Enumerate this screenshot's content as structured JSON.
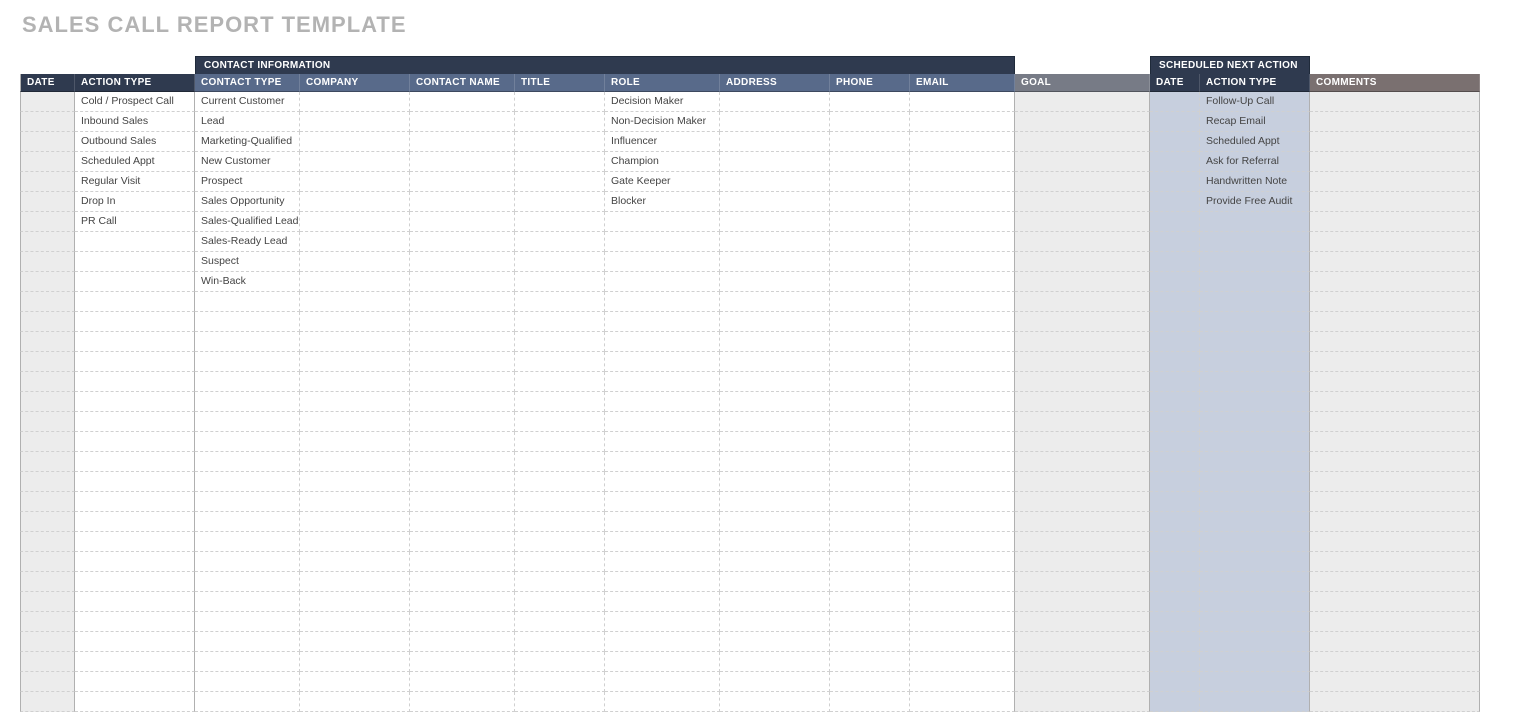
{
  "title": "SALES CALL REPORT TEMPLATE",
  "group_headers": {
    "contact_info": "CONTACT INFORMATION",
    "scheduled_next": "SCHEDULED NEXT ACTION"
  },
  "headers": {
    "date": "DATE",
    "action_type": "ACTION TYPE",
    "contact_type": "CONTACT TYPE",
    "company": "COMPANY",
    "contact_name": "CONTACT NAME",
    "title_col": "TITLE",
    "role": "ROLE",
    "address": "ADDRESS",
    "phone": "PHONE",
    "email": "EMAIL",
    "goal": "GOAL",
    "next_date": "DATE",
    "next_action_type": "ACTION TYPE",
    "comments": "COMMENTS"
  },
  "rows": [
    {
      "action_type": "Cold / Prospect Call",
      "contact_type": "Current Customer",
      "role": "Decision Maker",
      "next_action_type": "Follow-Up Call"
    },
    {
      "action_type": "Inbound Sales",
      "contact_type": "Lead",
      "role": "Non-Decision Maker",
      "next_action_type": "Recap Email"
    },
    {
      "action_type": "Outbound Sales",
      "contact_type": "Marketing-Qualified",
      "role": "Influencer",
      "next_action_type": "Scheduled Appt"
    },
    {
      "action_type": "Scheduled Appt",
      "contact_type": "New Customer",
      "role": "Champion",
      "next_action_type": "Ask for Referral"
    },
    {
      "action_type": "Regular Visit",
      "contact_type": "Prospect",
      "role": "Gate Keeper",
      "next_action_type": "Handwritten Note"
    },
    {
      "action_type": "Drop In",
      "contact_type": "Sales Opportunity",
      "role": "Blocker",
      "next_action_type": "Provide Free Audit"
    },
    {
      "action_type": "PR Call",
      "contact_type": "Sales-Qualified Lead",
      "role": "",
      "next_action_type": ""
    },
    {
      "action_type": "",
      "contact_type": "Sales-Ready Lead",
      "role": "",
      "next_action_type": ""
    },
    {
      "action_type": "",
      "contact_type": "Suspect",
      "role": "",
      "next_action_type": ""
    },
    {
      "action_type": "",
      "contact_type": "Win-Back",
      "role": "",
      "next_action_type": ""
    },
    {},
    {},
    {},
    {},
    {},
    {},
    {},
    {},
    {},
    {},
    {},
    {},
    {},
    {},
    {},
    {},
    {},
    {},
    {},
    {},
    {}
  ]
}
